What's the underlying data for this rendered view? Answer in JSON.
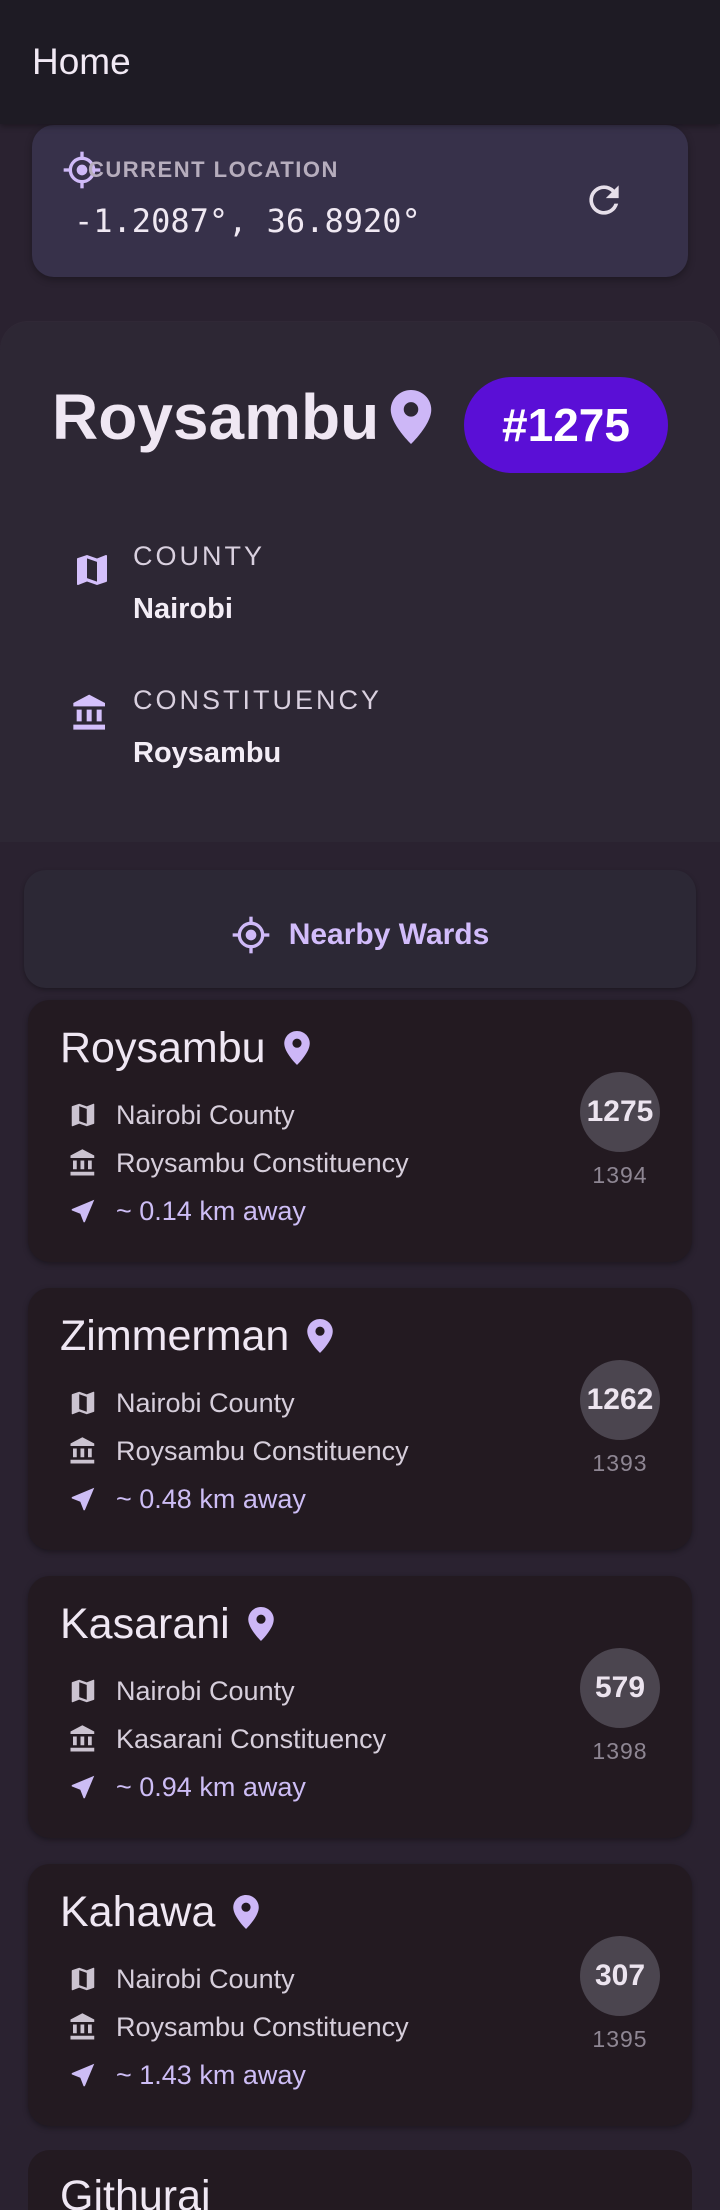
{
  "appbar": {
    "title": "Home"
  },
  "location": {
    "label": "CURRENT LOCATION",
    "coords": "-1.2087°, 36.8920°"
  },
  "ward": {
    "name": "Roysambu",
    "number": "#1275",
    "county_label": "COUNTY",
    "county": "Nairobi",
    "constituency_label": "CONSTITUENCY",
    "constituency": "Roysambu"
  },
  "nearby": {
    "title": "Nearby Wards",
    "items": [
      {
        "name": "Roysambu",
        "county": "Nairobi County",
        "constituency": "Roysambu Constituency",
        "distance": "~ 0.14 km away",
        "number": "1275",
        "sub": "1394"
      },
      {
        "name": "Zimmerman",
        "county": "Nairobi County",
        "constituency": "Roysambu Constituency",
        "distance": "~ 0.48 km away",
        "number": "1262",
        "sub": "1393"
      },
      {
        "name": "Kasarani",
        "county": "Nairobi County",
        "constituency": "Kasarani Constituency",
        "distance": "~ 0.94 km away",
        "number": "579",
        "sub": "1398"
      },
      {
        "name": "Kahawa",
        "county": "Nairobi County",
        "constituency": "Roysambu Constituency",
        "distance": "~ 1.43 km away",
        "number": "307",
        "sub": "1395"
      }
    ],
    "partial_item": {
      "name": "Githurai"
    }
  },
  "colors": {
    "accent": "#d2bcfb",
    "badge": "#5a0fd6",
    "background": "#2a2230",
    "card": "#231a21"
  },
  "icons": {
    "location": "my-location-icon",
    "refresh": "refresh-icon",
    "pin": "map-pin-icon",
    "map": "map-icon",
    "building": "bank-building-icon",
    "navigate": "navigation-arrow-icon"
  }
}
